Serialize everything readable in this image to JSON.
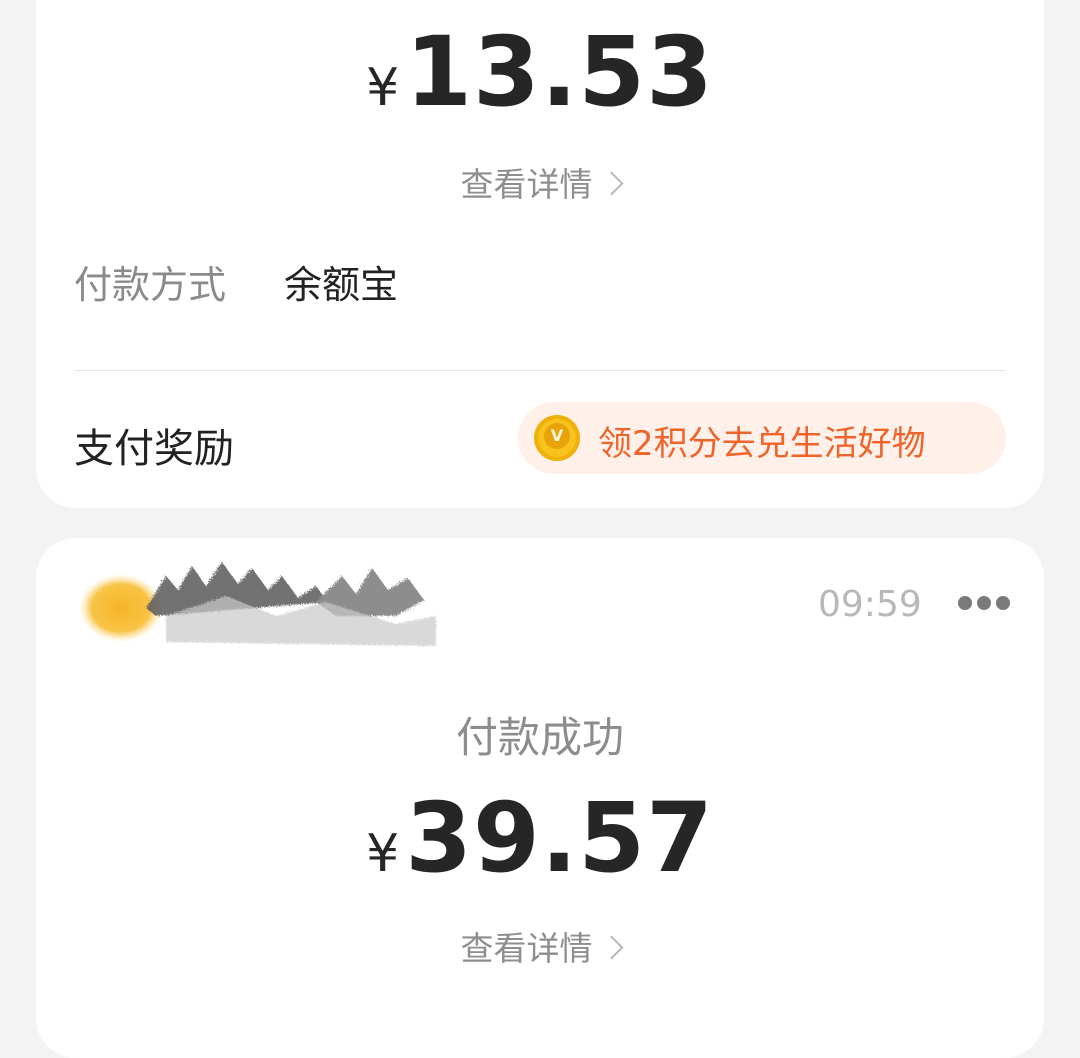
{
  "transaction1": {
    "currency_symbol": "¥",
    "amount": "13.53",
    "details_link": "查看详情",
    "payment_method_label": "付款方式",
    "payment_method_value": "余额宝",
    "reward_label": "支付奖励",
    "reward_text": "领2积分去兑生活好物"
  },
  "transaction2": {
    "time": "09:59",
    "status": "付款成功",
    "currency_symbol": "¥",
    "amount": "39.57",
    "details_link": "查看详情"
  },
  "icons": {
    "coin": "coin-icon",
    "chevron": "chevron-right-icon",
    "more": "more-icon"
  },
  "colors": {
    "reward_text": "#f0642a",
    "reward_pill_bg": "#fff0ea",
    "coin": "#f7c31c"
  }
}
